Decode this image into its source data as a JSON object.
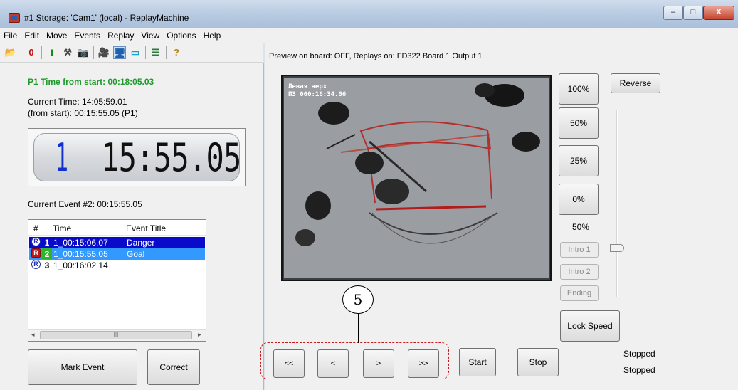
{
  "window": {
    "title": "#1 Storage: 'Cam1' (local) - ReplayMachine",
    "min_glyph": "–",
    "max_glyph": "□",
    "close_glyph": "X"
  },
  "menu": [
    "File",
    "Edit",
    "Move",
    "Events",
    "Replay",
    "View",
    "Options",
    "Help"
  ],
  "toolbar": {
    "icons": [
      {
        "name": "open-folder-icon",
        "glyph": "📂"
      },
      {
        "name": "zero-icon",
        "glyph": "0"
      },
      {
        "name": "in-mark-icon",
        "glyph": "I"
      },
      {
        "name": "tools-icon",
        "glyph": "⚒"
      },
      {
        "name": "marker-icon",
        "glyph": "📷"
      },
      {
        "name": "camera-icon",
        "glyph": "🎥"
      },
      {
        "name": "monitor-icon",
        "glyph": "🖥"
      },
      {
        "name": "display-icon",
        "glyph": "▭"
      },
      {
        "name": "list-icon",
        "glyph": "☰"
      },
      {
        "name": "help-icon",
        "glyph": "?"
      }
    ]
  },
  "left": {
    "p1_time": "P1 Time from start: 00:18:05.03",
    "current_time": "Current Time: 14:05:59.01",
    "from_start": "(from start): 00:15:55.05 (P1)",
    "clock_event": "1",
    "clock_time": "15:55.05",
    "current_event": "Current Event #2: 00:15:55.05",
    "list": {
      "headers": [
        "#",
        "Time",
        "Event Title"
      ],
      "rows": [
        {
          "num": "1",
          "time": "1_00:15:06.07",
          "title": "Danger"
        },
        {
          "num": "2",
          "time": "1_00:15:55.05",
          "title": "Goal"
        },
        {
          "num": "3",
          "time": "1_00:16:02.14",
          "title": ""
        }
      ],
      "badge": "R",
      "scroll_left": "◂",
      "scroll_right": "▸",
      "thumb_grip": "III"
    },
    "mark_event": "Mark Event",
    "correct": "Correct"
  },
  "right": {
    "preview_info": "Preview on board: OFF, Replays on: FD322 Board 1 Output 1",
    "video_caption1": "Левая верх",
    "video_caption2": "П3_000:16:34.06",
    "speed_100": "100%",
    "speed_50": "50%",
    "speed_25": "25%",
    "speed_0": "0%",
    "reverse": "Reverse",
    "speed_readout": "50%",
    "intro1": "Intro 1",
    "intro2": "Intro 2",
    "ending": "Ending",
    "lock_speed": "Lock Speed",
    "nav": [
      "<<",
      "<",
      ">",
      ">>"
    ],
    "start": "Start",
    "stop": "Stop",
    "status1": "Stopped",
    "status2": "Stopped"
  },
  "callout": {
    "number": "5"
  }
}
